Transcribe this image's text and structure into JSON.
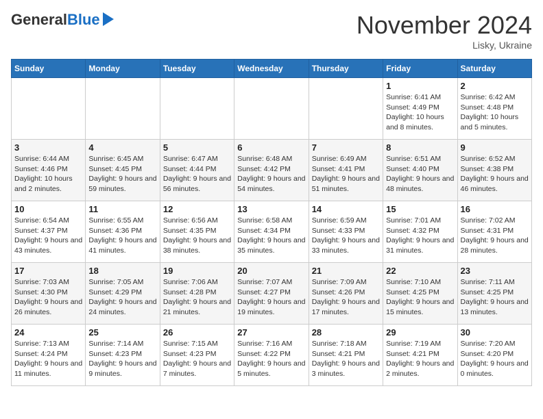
{
  "header": {
    "logo_general": "General",
    "logo_blue": "Blue",
    "month_year": "November 2024",
    "location": "Lisky, Ukraine"
  },
  "calendar": {
    "days_of_week": [
      "Sunday",
      "Monday",
      "Tuesday",
      "Wednesday",
      "Thursday",
      "Friday",
      "Saturday"
    ],
    "weeks": [
      [
        {
          "day": "",
          "info": ""
        },
        {
          "day": "",
          "info": ""
        },
        {
          "day": "",
          "info": ""
        },
        {
          "day": "",
          "info": ""
        },
        {
          "day": "",
          "info": ""
        },
        {
          "day": "1",
          "info": "Sunrise: 6:41 AM\nSunset: 4:49 PM\nDaylight: 10 hours and 8 minutes."
        },
        {
          "day": "2",
          "info": "Sunrise: 6:42 AM\nSunset: 4:48 PM\nDaylight: 10 hours and 5 minutes."
        }
      ],
      [
        {
          "day": "3",
          "info": "Sunrise: 6:44 AM\nSunset: 4:46 PM\nDaylight: 10 hours and 2 minutes."
        },
        {
          "day": "4",
          "info": "Sunrise: 6:45 AM\nSunset: 4:45 PM\nDaylight: 9 hours and 59 minutes."
        },
        {
          "day": "5",
          "info": "Sunrise: 6:47 AM\nSunset: 4:44 PM\nDaylight: 9 hours and 56 minutes."
        },
        {
          "day": "6",
          "info": "Sunrise: 6:48 AM\nSunset: 4:42 PM\nDaylight: 9 hours and 54 minutes."
        },
        {
          "day": "7",
          "info": "Sunrise: 6:49 AM\nSunset: 4:41 PM\nDaylight: 9 hours and 51 minutes."
        },
        {
          "day": "8",
          "info": "Sunrise: 6:51 AM\nSunset: 4:40 PM\nDaylight: 9 hours and 48 minutes."
        },
        {
          "day": "9",
          "info": "Sunrise: 6:52 AM\nSunset: 4:38 PM\nDaylight: 9 hours and 46 minutes."
        }
      ],
      [
        {
          "day": "10",
          "info": "Sunrise: 6:54 AM\nSunset: 4:37 PM\nDaylight: 9 hours and 43 minutes."
        },
        {
          "day": "11",
          "info": "Sunrise: 6:55 AM\nSunset: 4:36 PM\nDaylight: 9 hours and 41 minutes."
        },
        {
          "day": "12",
          "info": "Sunrise: 6:56 AM\nSunset: 4:35 PM\nDaylight: 9 hours and 38 minutes."
        },
        {
          "day": "13",
          "info": "Sunrise: 6:58 AM\nSunset: 4:34 PM\nDaylight: 9 hours and 35 minutes."
        },
        {
          "day": "14",
          "info": "Sunrise: 6:59 AM\nSunset: 4:33 PM\nDaylight: 9 hours and 33 minutes."
        },
        {
          "day": "15",
          "info": "Sunrise: 7:01 AM\nSunset: 4:32 PM\nDaylight: 9 hours and 31 minutes."
        },
        {
          "day": "16",
          "info": "Sunrise: 7:02 AM\nSunset: 4:31 PM\nDaylight: 9 hours and 28 minutes."
        }
      ],
      [
        {
          "day": "17",
          "info": "Sunrise: 7:03 AM\nSunset: 4:30 PM\nDaylight: 9 hours and 26 minutes."
        },
        {
          "day": "18",
          "info": "Sunrise: 7:05 AM\nSunset: 4:29 PM\nDaylight: 9 hours and 24 minutes."
        },
        {
          "day": "19",
          "info": "Sunrise: 7:06 AM\nSunset: 4:28 PM\nDaylight: 9 hours and 21 minutes."
        },
        {
          "day": "20",
          "info": "Sunrise: 7:07 AM\nSunset: 4:27 PM\nDaylight: 9 hours and 19 minutes."
        },
        {
          "day": "21",
          "info": "Sunrise: 7:09 AM\nSunset: 4:26 PM\nDaylight: 9 hours and 17 minutes."
        },
        {
          "day": "22",
          "info": "Sunrise: 7:10 AM\nSunset: 4:25 PM\nDaylight: 9 hours and 15 minutes."
        },
        {
          "day": "23",
          "info": "Sunrise: 7:11 AM\nSunset: 4:25 PM\nDaylight: 9 hours and 13 minutes."
        }
      ],
      [
        {
          "day": "24",
          "info": "Sunrise: 7:13 AM\nSunset: 4:24 PM\nDaylight: 9 hours and 11 minutes."
        },
        {
          "day": "25",
          "info": "Sunrise: 7:14 AM\nSunset: 4:23 PM\nDaylight: 9 hours and 9 minutes."
        },
        {
          "day": "26",
          "info": "Sunrise: 7:15 AM\nSunset: 4:23 PM\nDaylight: 9 hours and 7 minutes."
        },
        {
          "day": "27",
          "info": "Sunrise: 7:16 AM\nSunset: 4:22 PM\nDaylight: 9 hours and 5 minutes."
        },
        {
          "day": "28",
          "info": "Sunrise: 7:18 AM\nSunset: 4:21 PM\nDaylight: 9 hours and 3 minutes."
        },
        {
          "day": "29",
          "info": "Sunrise: 7:19 AM\nSunset: 4:21 PM\nDaylight: 9 hours and 2 minutes."
        },
        {
          "day": "30",
          "info": "Sunrise: 7:20 AM\nSunset: 4:20 PM\nDaylight: 9 hours and 0 minutes."
        }
      ]
    ]
  }
}
